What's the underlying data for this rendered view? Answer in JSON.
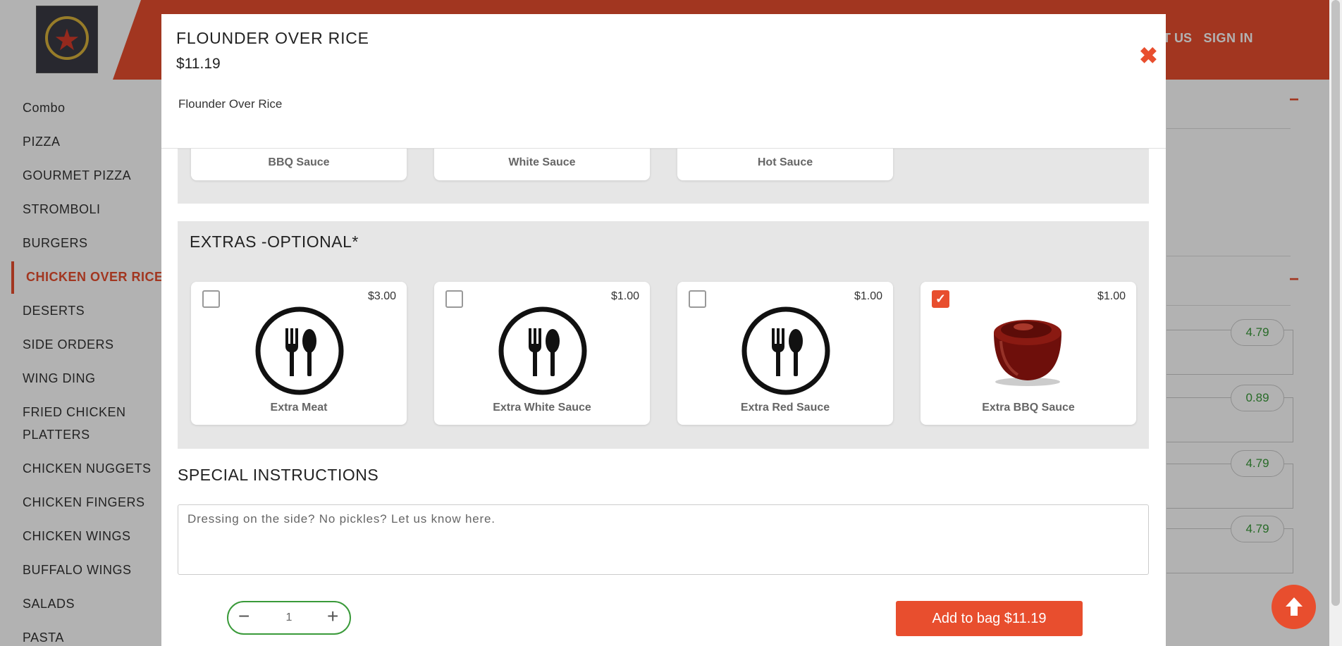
{
  "header": {
    "contact_label": "ACT US",
    "signin_label": "SIGN IN",
    "brand_color": "#e84e2e"
  },
  "sidebar": {
    "items": [
      {
        "label": "Combo"
      },
      {
        "label": "PIZZA"
      },
      {
        "label": "GOURMET PIZZA"
      },
      {
        "label": "STROMBOLI"
      },
      {
        "label": "BURGERS"
      },
      {
        "label": "CHICKEN OVER RICE",
        "active": true
      },
      {
        "label": "DESERTS"
      },
      {
        "label": "SIDE ORDERS"
      },
      {
        "label": "WING DING"
      },
      {
        "label": "FRIED CHICKEN"
      },
      {
        "label": "PLATTERS"
      },
      {
        "label": "CHICKEN NUGGETS"
      },
      {
        "label": "CHICKEN FINGERS"
      },
      {
        "label": "CHICKEN WINGS"
      },
      {
        "label": "BUFFALO WINGS"
      },
      {
        "label": "SALADS"
      },
      {
        "label": "PASTA"
      }
    ]
  },
  "right_panel": {
    "prices": [
      "4.79",
      "0.89",
      "4.79",
      "4.79"
    ]
  },
  "modal": {
    "title": "FLOUNDER OVER RICE",
    "price": "$11.19",
    "description": "Flounder Over Rice",
    "close_icon": "close-icon",
    "sauce_group": {
      "options": [
        {
          "label": "BBQ Sauce"
        },
        {
          "label": "White Sauce"
        },
        {
          "label": "Hot Sauce"
        }
      ]
    },
    "extras_group": {
      "title": "EXTRAS -OPTIONAL*",
      "options": [
        {
          "label": "Extra Meat",
          "price": "$3.00",
          "checked": false,
          "icon": "utensils-icon"
        },
        {
          "label": "Extra White Sauce",
          "price": "$1.00",
          "checked": false,
          "icon": "utensils-icon"
        },
        {
          "label": "Extra Red Sauce",
          "price": "$1.00",
          "checked": false,
          "icon": "utensils-icon"
        },
        {
          "label": "Extra BBQ Sauce",
          "price": "$1.00",
          "checked": true,
          "icon": "bbq-sauce-image"
        }
      ]
    },
    "special_instructions": {
      "title": "SPECIAL INSTRUCTIONS",
      "placeholder": "Dressing on the side? No pickles? Let us know here."
    },
    "quantity": {
      "value": "1",
      "minus": "−",
      "plus": "+"
    },
    "add_button_label": "Add to bag $11.19"
  }
}
